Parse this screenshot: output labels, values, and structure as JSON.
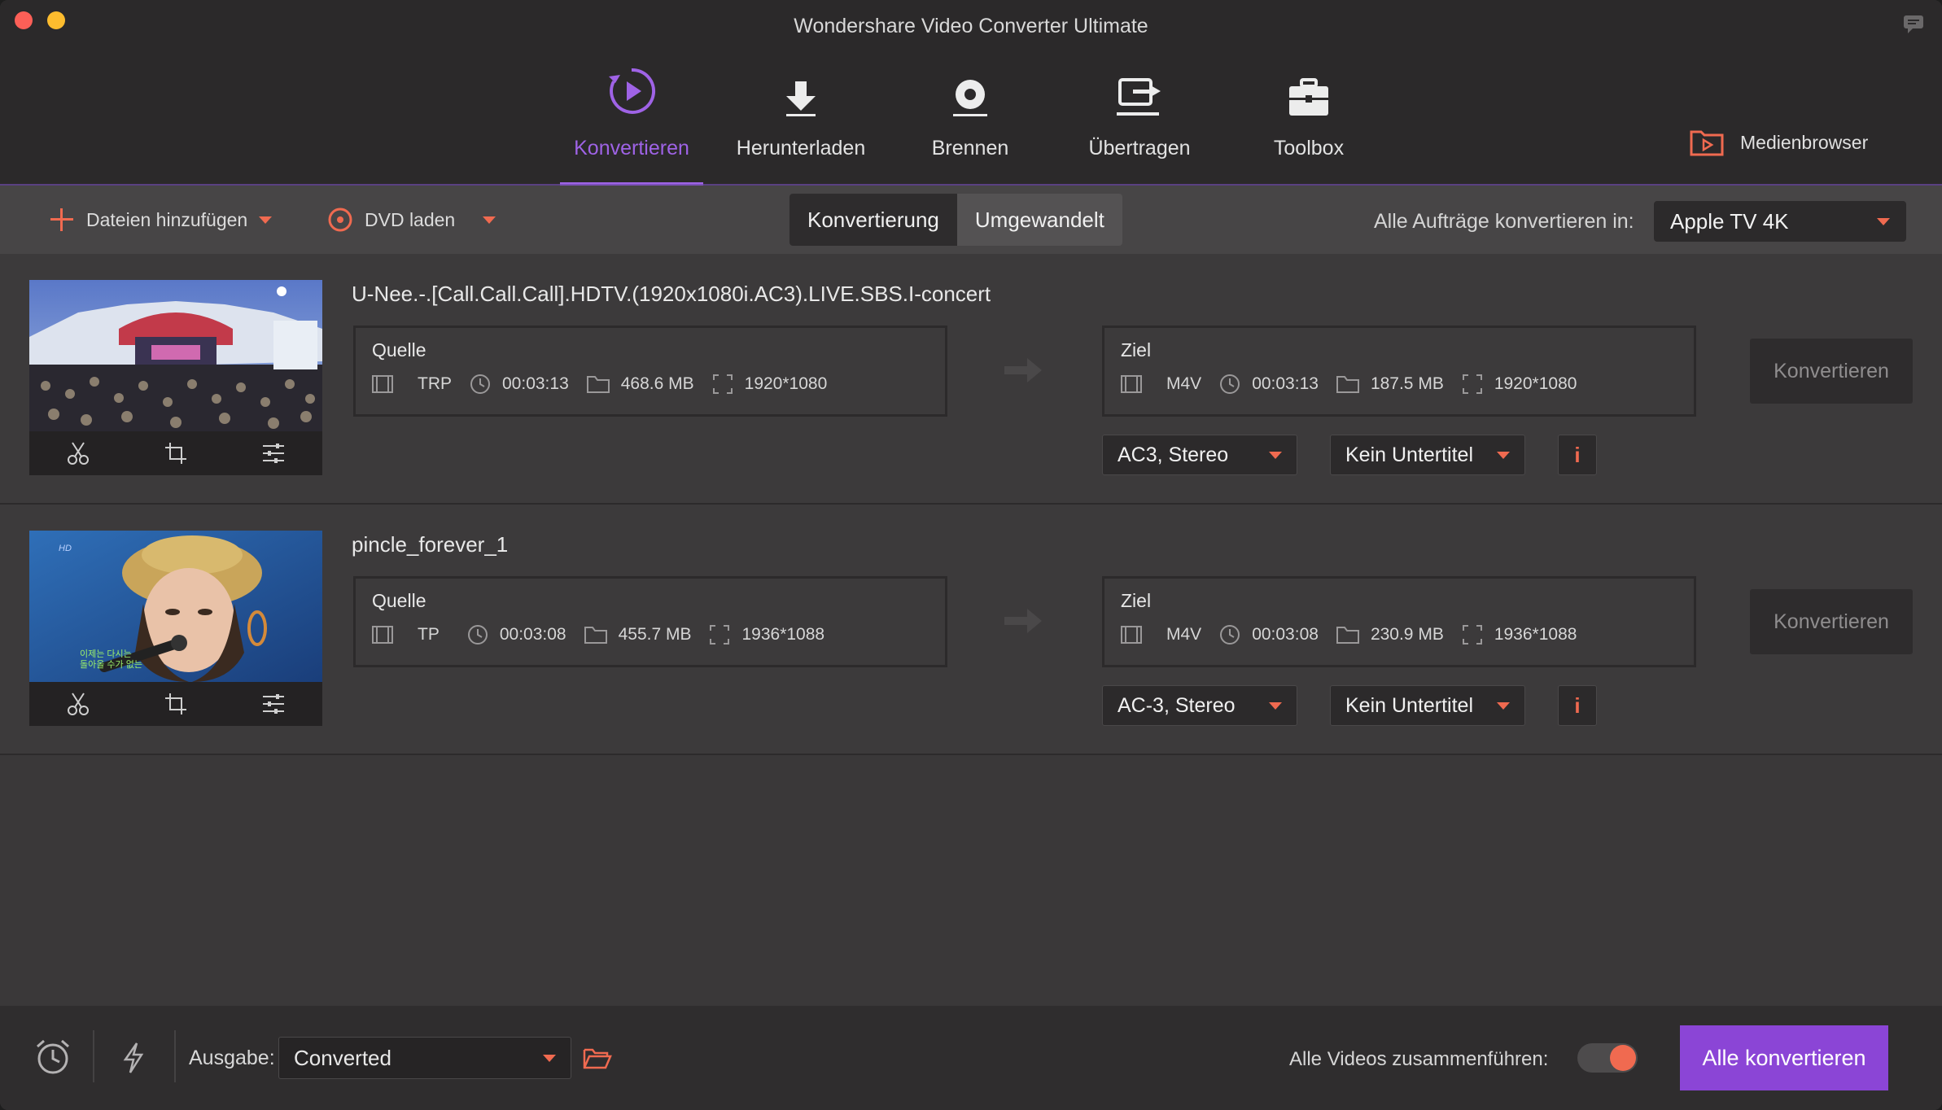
{
  "window": {
    "title": "Wondershare Video Converter Ultimate"
  },
  "nav": {
    "items": [
      {
        "label": "Konvertieren",
        "active": true
      },
      {
        "label": "Herunterladen",
        "active": false
      },
      {
        "label": "Brennen",
        "active": false
      },
      {
        "label": "Übertragen",
        "active": false
      },
      {
        "label": "Toolbox",
        "active": false
      }
    ],
    "media_browser": "Medienbrowser"
  },
  "toolbar": {
    "add_files": "Dateien hinzufügen",
    "load_dvd": "DVD laden",
    "tabs": [
      {
        "label": "Konvertierung",
        "active": true
      },
      {
        "label": "Umgewandelt",
        "active": false
      }
    ],
    "convert_all_label": "Alle Aufträge konvertieren in:",
    "convert_all_preset": "Apple TV 4K"
  },
  "files": [
    {
      "title": "U-Nee.-.[Call.Call.Call].HDTV.(1920x1080i.AC3).LIVE.SBS.I-concert",
      "source": {
        "label": "Quelle",
        "format": "TRP",
        "duration": "00:03:13",
        "size": "468.6 MB",
        "resolution": "1920*1080"
      },
      "target": {
        "label": "Ziel",
        "format": "M4V",
        "duration": "00:03:13",
        "size": "187.5 MB",
        "resolution": "1920*1080"
      },
      "audio": "AC3, Stereo",
      "subtitle": "Kein Untertitel",
      "info": "i",
      "convert": "Konvertieren"
    },
    {
      "title": "pincle_forever_1",
      "thumb_badge": "HD",
      "thumb_caption_1": "이제는 다시는",
      "thumb_caption_2": "돌아올 수가 없는",
      "source": {
        "label": "Quelle",
        "format": "TP",
        "duration": "00:03:08",
        "size": "455.7 MB",
        "resolution": "1936*1088"
      },
      "target": {
        "label": "Ziel",
        "format": "M4V",
        "duration": "00:03:08",
        "size": "230.9 MB",
        "resolution": "1936*1088"
      },
      "audio": "AC-3, Stereo",
      "subtitle": "Kein Untertitel",
      "info": "i",
      "convert": "Konvertieren"
    }
  ],
  "footer": {
    "output_label": "Ausgabe:",
    "output_value": "Converted",
    "merge_label": "Alle Videos zusammenführen:",
    "merge_enabled": true,
    "convert_all": "Alle konvertieren"
  },
  "colors": {
    "accent": "#9f63e6",
    "orange": "#f06a50",
    "button": "#8b45d6"
  }
}
